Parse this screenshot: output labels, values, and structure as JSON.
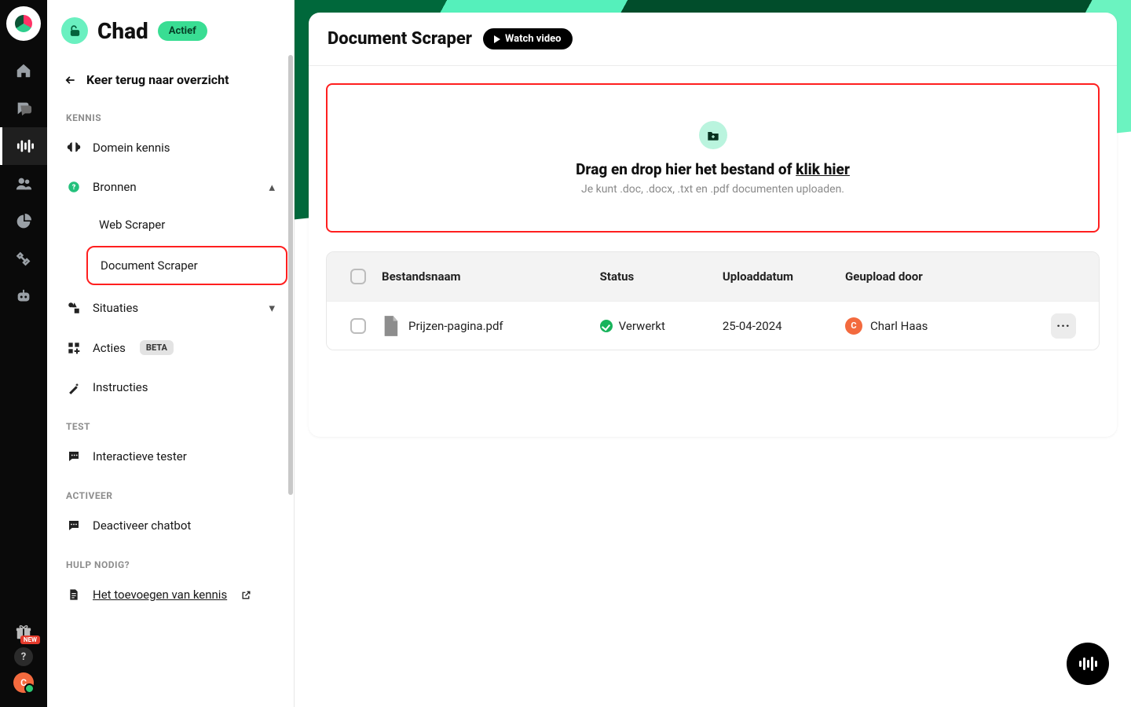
{
  "rail": {
    "giftBadge": "NEW",
    "help": "?",
    "avatarInitial": "C"
  },
  "side": {
    "botName": "Chad",
    "statusPill": "Actief",
    "back": "Keer terug naar overzicht",
    "sections": {
      "kennis": "KENNIS",
      "test": "TEST",
      "activeer": "ACTIVEER",
      "hulp": "HULP NODIG?"
    },
    "items": {
      "domein": "Domein kennis",
      "bronnen": "Bronnen",
      "web": "Web Scraper",
      "doc": "Document Scraper",
      "situaties": "Situaties",
      "acties": "Acties",
      "betaTag": "BETA",
      "instructies": "Instructies",
      "tester": "Interactieve tester",
      "deact": "Deactiveer chatbot",
      "help": "Het toevoegen van kennis"
    }
  },
  "page": {
    "title": "Document Scraper",
    "watch": "Watch video",
    "drop": {
      "title_a": "Drag en drop hier het bestand of ",
      "title_b": "klik hier",
      "sub": "Je kunt .doc, .docx, .txt en .pdf documenten uploaden."
    },
    "table": {
      "headers": {
        "name": "Bestandsnaam",
        "status": "Status",
        "date": "Uploaddatum",
        "by": "Geupload door"
      },
      "rows": [
        {
          "file": "Prijzen-pagina.pdf",
          "status": "Verwerkt",
          "date": "25-04-2024",
          "byInitial": "C",
          "byName": "Charl Haas"
        }
      ]
    }
  }
}
